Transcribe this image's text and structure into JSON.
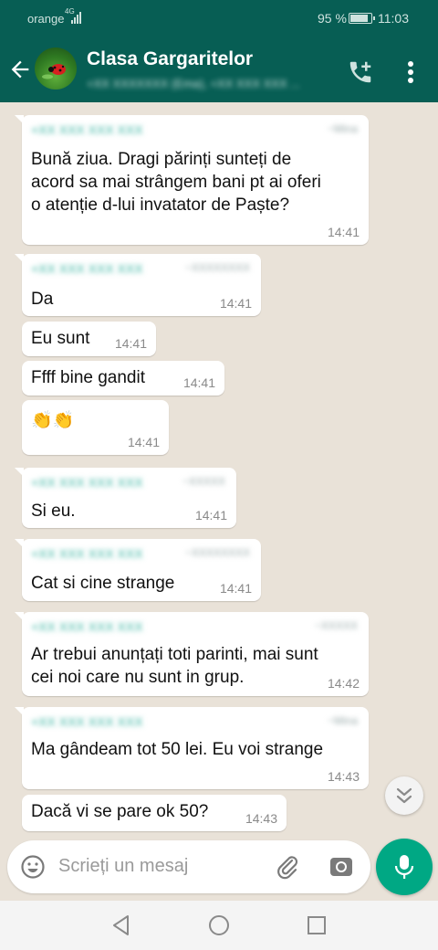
{
  "status_bar": {
    "carrier": "orange",
    "network": "4G",
    "battery_percent": "95 %",
    "time": "11:03"
  },
  "header": {
    "title": "Clasa Gargaritelor",
    "subtitle": "+XX XXXXXXX (Ema), +XX XXX XXX ..."
  },
  "messages": [
    {
      "sender": "+XX XXX XXX XXX",
      "sender_meta": "~Mina",
      "text": "Bună ziua. Dragi părinți sunteți de\nacord sa mai strângem bani pt ai oferi\no atenție d-lui invatator de Paște?",
      "time": "14:41"
    },
    {
      "sender": "+XX XXX XXX XXX",
      "sender_meta": "~XXXXXXXX",
      "text": "Da",
      "time": "14:41"
    },
    {
      "text": "Eu sunt",
      "time": "14:41"
    },
    {
      "text": "Ffff bine gandit",
      "time": "14:41"
    },
    {
      "text": "👏👏",
      "time": "14:41"
    },
    {
      "sender": "+XX XXX XXX XXX",
      "sender_meta": "~XXXXX",
      "text": "Si eu.",
      "time": "14:41"
    },
    {
      "sender": "+XX XXX XXX XXX",
      "sender_meta": "~XXXXXXXX",
      "text": "Cat si cine strange",
      "time": "14:41"
    },
    {
      "sender": "+XX XXX XXX XXX",
      "sender_meta": "~XXXXX",
      "text": "Ar trebui anunțați toti parinti, mai sunt\ncei noi care nu sunt in grup.",
      "time": "14:42"
    },
    {
      "sender": "+XX XXX XXX XXX",
      "sender_meta": "~Mina",
      "text": "Ma gândeam tot 50 lei. Eu voi strange",
      "time": "14:43"
    },
    {
      "text": "Dacă vi se pare ok 50?",
      "time": "14:43"
    }
  ],
  "input": {
    "placeholder": "Scrieți un mesaj"
  },
  "colors": {
    "header": "#075e54",
    "chat_background": "#e9e2d8",
    "bubble": "#ffffff",
    "sender_name": "#36b3a0",
    "mic_button": "#00a884"
  },
  "icons": [
    "back-arrow-icon",
    "add-call-icon",
    "more-vert-icon",
    "chevron-double-down-icon",
    "emoji-icon",
    "attach-icon",
    "camera-icon",
    "mic-icon",
    "nav-back-icon",
    "nav-home-icon",
    "nav-recents-icon"
  ]
}
